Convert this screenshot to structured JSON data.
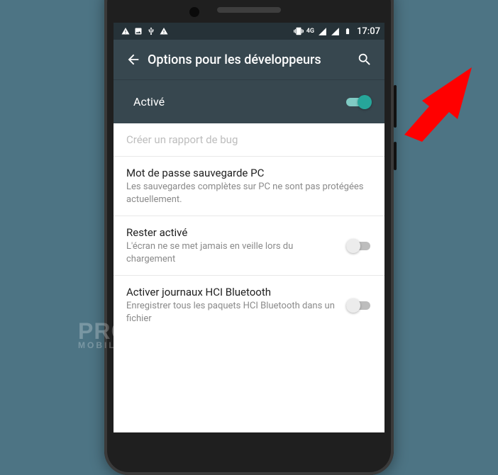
{
  "statusbar": {
    "clock": "17:07",
    "icons_left": [
      "warning-icon",
      "image-icon",
      "usb-icon",
      "warning-icon"
    ],
    "icons_right": [
      "vibrate-icon",
      "4g-label",
      "signal-icon",
      "signal-icon",
      "battery-icon"
    ],
    "network_label": "4G"
  },
  "appbar": {
    "title": "Options pour les développeurs",
    "back_icon": "arrow-back-icon",
    "search_icon": "search-icon"
  },
  "master_toggle": {
    "label": "Activé",
    "on": true
  },
  "items": [
    {
      "title": "Créer un rapport de bug",
      "subtitle": "",
      "disabled": true,
      "has_toggle": false
    },
    {
      "title": "Mot de passe sauvegarde PC",
      "subtitle": "Les sauvegardes complètes sur PC ne sont pas protégées actuellement.",
      "disabled": false,
      "has_toggle": false
    },
    {
      "title": "Rester activé",
      "subtitle": "L'écran ne se met jamais en veille lors du chargement",
      "disabled": false,
      "has_toggle": true,
      "toggle_on": false
    },
    {
      "title": "Activer journaux HCI Bluetooth",
      "subtitle": "Enregistrer tous les paquets HCI Bluetooth dans un fichier",
      "disabled": false,
      "has_toggle": true,
      "toggle_on": false
    }
  ],
  "colors": {
    "page_bg": "#4d7484",
    "appbar_bg": "#37474f",
    "accent": "#26a69a",
    "arrow": "#ff0000"
  },
  "watermark": {
    "main": "PRODIGE",
    "sub": "MOBILE"
  }
}
